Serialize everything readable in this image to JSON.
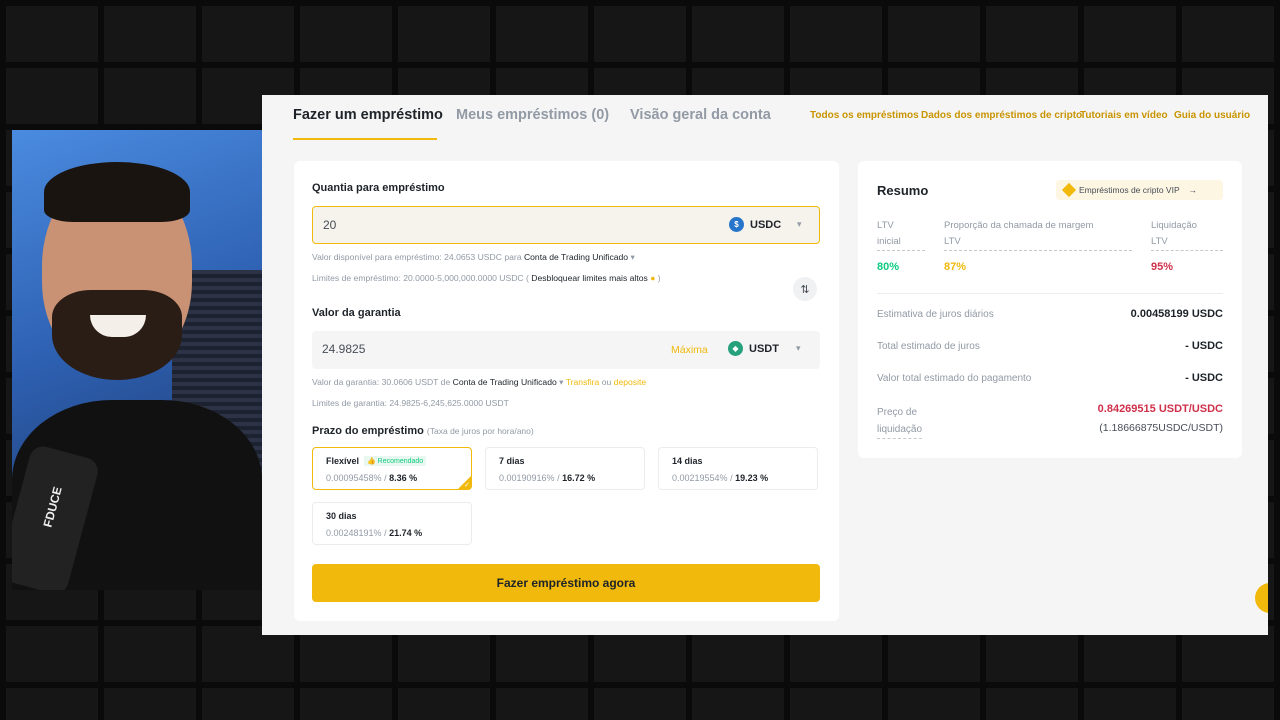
{
  "tabs": [
    {
      "label": "Fazer um empréstimo",
      "active": true
    },
    {
      "label": "Meus empréstimos (0)",
      "active": false
    },
    {
      "label": "Visão geral da conta",
      "active": false
    }
  ],
  "top_links": [
    "Todos os empréstimos",
    "Dados dos empréstimos de cripto",
    "Tutoriais em vídeo",
    "Guia do usuário"
  ],
  "loan": {
    "label": "Quantia para empréstimo",
    "amount": "20",
    "coin": "USDC",
    "available_prefix": "Valor disponível para empréstimo: 24.0653 USDC para",
    "available_account": "Conta de Trading Unificado",
    "limits_prefix": "Limites de empréstimo: 20.0000-5,000,000.0000 USDC (",
    "unlock_link": "Desbloquear limites mais altos",
    "limits_suffix": ")"
  },
  "collateral": {
    "label": "Valor da garantia",
    "amount": "24.9825",
    "max_label": "Máxima",
    "coin": "USDT",
    "value_prefix": "Valor da garantia: 30.0606 USDT de",
    "value_account": "Conta de Trading Unificado",
    "transfer_link": "Transfira",
    "or_text": "ou",
    "deposit_link": "deposite",
    "limits": "Limites de garantia: 24.9825-6,245,625.0000 USDT"
  },
  "term": {
    "label": "Prazo do empréstimo",
    "hint": "(Taxa de juros por hora/ano)",
    "options": [
      {
        "name": "Flexível",
        "badge": "Recomendado",
        "hourly": "0.00095458%",
        "sep": "/",
        "annual": "8.36 %",
        "selected": true
      },
      {
        "name": "7 dias",
        "hourly": "0.00190916%",
        "sep": "/",
        "annual": "16.72 %"
      },
      {
        "name": "14 dias",
        "hourly": "0.00219554%",
        "sep": "/",
        "annual": "19.23 %"
      },
      {
        "name": "30 dias",
        "hourly": "0.00248191%",
        "sep": "/",
        "annual": "21.74 %"
      }
    ]
  },
  "cta_label": "Fazer empréstimo agora",
  "summary": {
    "title": "Resumo",
    "vip_label": "Empréstimos de cripto VIP",
    "ltv_initial_label_1": "LTV",
    "ltv_initial_label_2": "inicial",
    "ltv_initial": "80%",
    "margin_call_label_1": "Proporção da chamada de margem",
    "margin_call_label_2": "LTV",
    "margin_call": "87%",
    "liquidation_label_1": "Liquidação",
    "liquidation_label_2": "LTV",
    "liquidation": "95%",
    "rows": [
      {
        "label": "Estimativa de juros diários",
        "value": "0.00458199 USDC"
      },
      {
        "label": "Total estimado de juros",
        "value": "- USDC"
      },
      {
        "label": "Valor total estimado do pagamento",
        "value": "- USDC"
      }
    ],
    "liq_price_label_1": "Preço de",
    "liq_price_label_2": "liquidação",
    "liq_price": "0.84269515 USDT/USDC",
    "liq_price_inverse": "(1.18666875USDC/USDT)"
  },
  "webcam": {
    "mic_brand": "FDUCE"
  },
  "colors": {
    "accent": "#f0b90b",
    "green": "#0ecb81",
    "red": "#cf304a",
    "orange": "#f0b90b"
  }
}
